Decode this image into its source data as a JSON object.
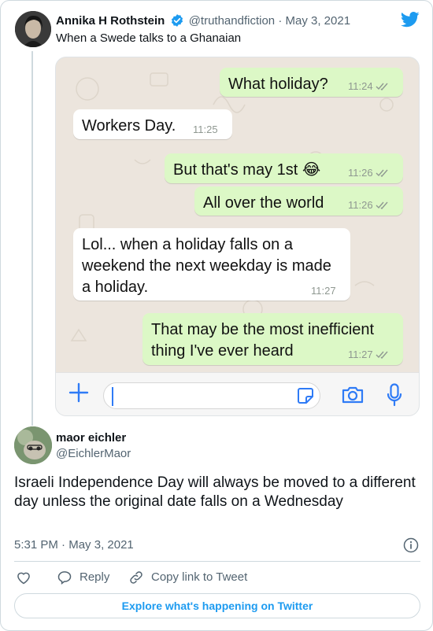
{
  "parent_tweet": {
    "author_name": "Annika H Rothstein",
    "handle": "@truthandfiction",
    "separator": "·",
    "date": "May 3, 2021",
    "text": "When a Swede talks to a Ghanaian"
  },
  "chat": {
    "messages": [
      {
        "direction": "outgoing",
        "text": "What holiday?",
        "time": "11:24",
        "read": true
      },
      {
        "direction": "incoming",
        "text": "Workers Day.",
        "time": "11:25"
      },
      {
        "direction": "outgoing",
        "text": "But that's may 1st 😂",
        "time": "11:26",
        "read": true
      },
      {
        "direction": "outgoing",
        "text": "All over the world",
        "time": "11:26",
        "read": true
      },
      {
        "direction": "incoming",
        "text": "Lol... when a holiday falls on a\nweekend the next weekday is made\na holiday.",
        "time": "11:27"
      },
      {
        "direction": "outgoing",
        "text": "That may be the most inefficient\nthing I've ever heard",
        "time": "11:27",
        "read": true
      }
    ],
    "colors": {
      "outgoing": "#dcf8c6",
      "incoming": "#ffffff",
      "accent": "#2f7bf6"
    },
    "input_icons": [
      "plus-icon",
      "sticker-icon",
      "camera-icon",
      "microphone-icon"
    ]
  },
  "reply_tweet": {
    "author_name": "maor eichler",
    "handle": "@EichlerMaor",
    "text": "Israeli Independence Day will always be moved to a different day unless the original date falls on a Wednesday",
    "time": "5:31 PM",
    "separator": "·",
    "date": "May 3, 2021"
  },
  "actions": {
    "reply_label": "Reply",
    "copy_link_label": "Copy link to Tweet"
  },
  "explore_label": "Explore what's happening on Twitter",
  "colors": {
    "twitter_blue": "#1d9bf0",
    "text": "#0f1419",
    "secondary": "#536471"
  }
}
